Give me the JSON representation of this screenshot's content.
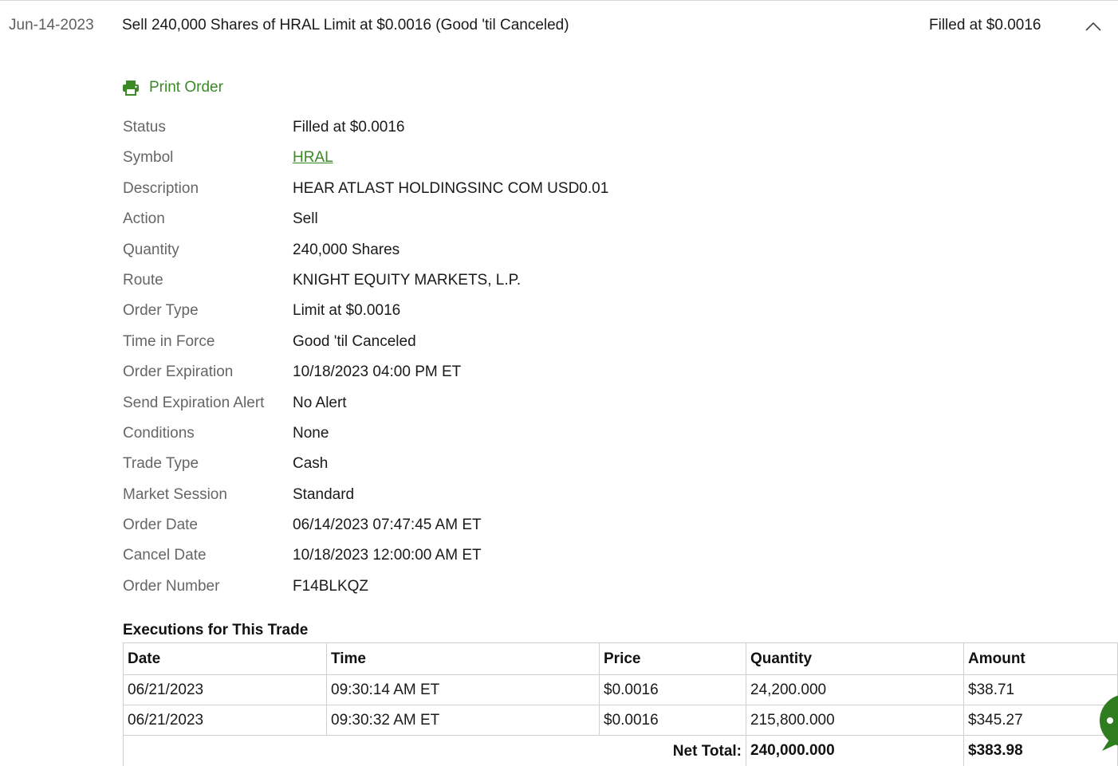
{
  "order": {
    "date": "Jun-14-2023",
    "summary": "Sell 240,000 Shares of HRAL Limit at $0.0016 (Good 'til Canceled)",
    "status": "Filled at $0.0016",
    "toggle_icon": "chevron-up-icon"
  },
  "print": {
    "label": "Print Order",
    "icon": "printer-icon"
  },
  "details": [
    {
      "label": "Status",
      "value": "Filled at $0.0016"
    },
    {
      "label": "Symbol",
      "value": "HRAL"
    },
    {
      "label": "Description",
      "value": "HEAR ATLAST HOLDINGSINC COM USD0.01"
    },
    {
      "label": "Action",
      "value": "Sell"
    },
    {
      "label": "Quantity",
      "value": "240,000 Shares"
    },
    {
      "label": "Route",
      "value": "KNIGHT EQUITY MARKETS, L.P."
    },
    {
      "label": "Order Type",
      "value": "Limit at $0.0016"
    },
    {
      "label": "Time in Force",
      "value": "Good 'til Canceled"
    },
    {
      "label": "Order Expiration",
      "value": "10/18/2023 04:00 PM ET"
    },
    {
      "label": "Send Expiration Alert",
      "value": "No Alert"
    },
    {
      "label": "Conditions",
      "value": "None"
    },
    {
      "label": "Trade Type",
      "value": "Cash"
    },
    {
      "label": "Market Session",
      "value": "Standard"
    },
    {
      "label": "Order Date",
      "value": "06/14/2023 07:47:45 AM ET"
    },
    {
      "label": "Cancel Date",
      "value": "10/18/2023 12:00:00 AM ET"
    },
    {
      "label": "Order Number",
      "value": "F14BLKQZ"
    }
  ],
  "executions": {
    "title": "Executions for This Trade",
    "columns": [
      "Date",
      "Time",
      "Price",
      "Quantity",
      "Amount"
    ],
    "rows": [
      [
        "06/21/2023",
        "09:30:14 AM ET",
        "$0.0016",
        "24,200.000",
        "$38.71"
      ],
      [
        "06/21/2023",
        "09:30:32 AM ET",
        "$0.0016",
        "215,800.000",
        "$345.27"
      ]
    ],
    "net_total_label": "Net Total:",
    "net_total_quantity": "240,000.000",
    "net_total_amount": "$383.98"
  },
  "colors": {
    "accent_green": "#3b8a25",
    "label_gray": "#666666",
    "border": "#cfcfcf",
    "chat_green": "#2e7d1f"
  },
  "chat": {
    "icon": "chat-bubble-icon"
  }
}
